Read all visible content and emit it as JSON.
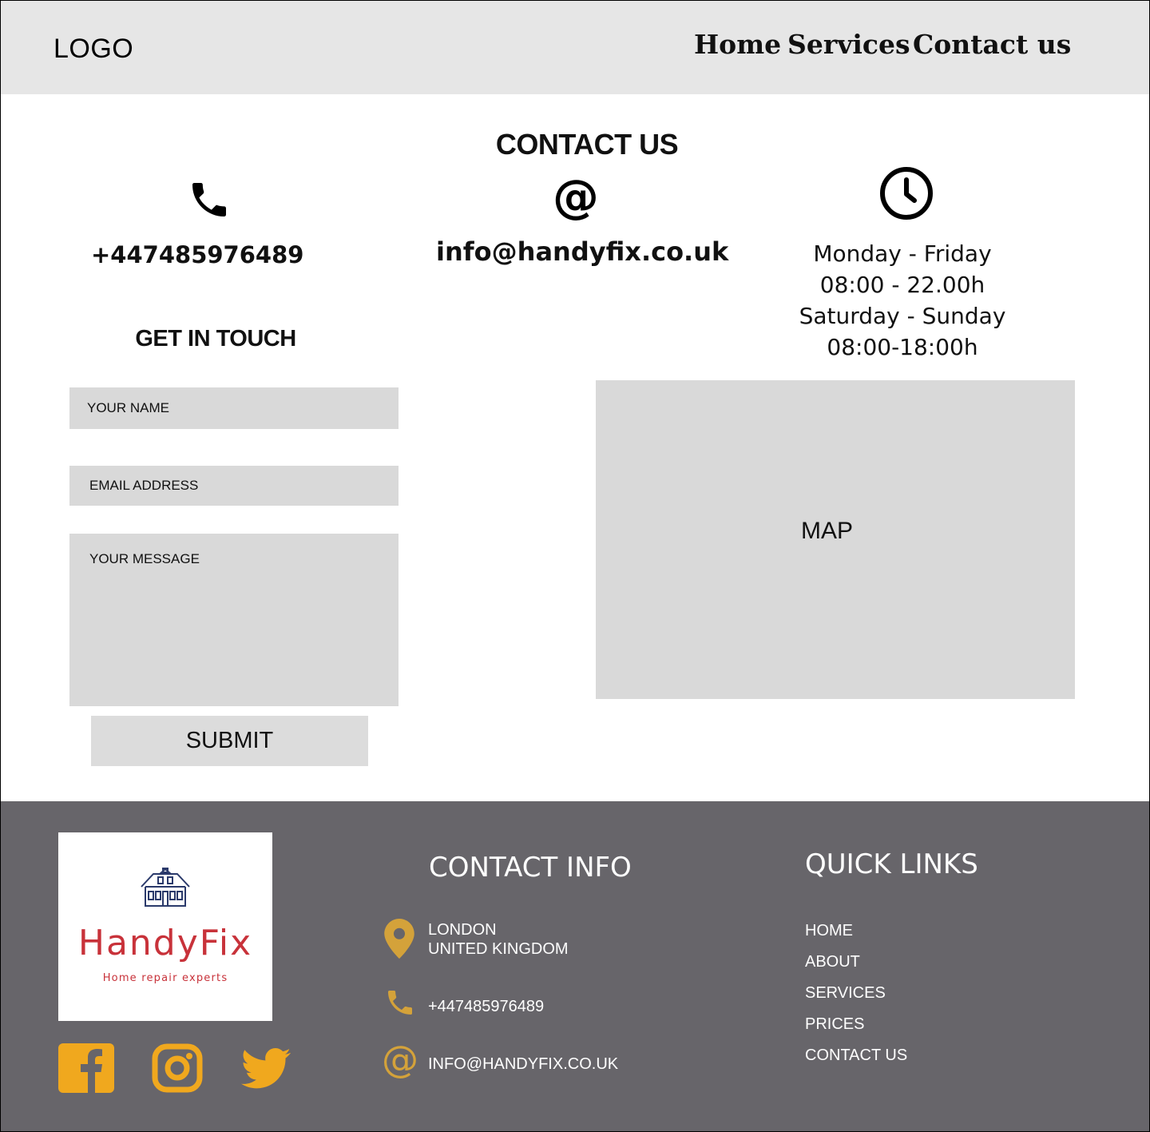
{
  "header": {
    "logo": "LOGO",
    "nav": [
      "Home",
      "Services",
      "Contact us"
    ]
  },
  "contact": {
    "title": "CONTACT US",
    "phone": "+447485976489",
    "email": "info@handyfix.co.uk",
    "hours": {
      "weekday_label": "Monday - Friday",
      "weekday_time": "08:00 - 22.00h",
      "weekend_label": "Saturday - Sunday",
      "weekend_time": "08:00-18:00h"
    }
  },
  "form": {
    "title": "GET IN TOUCH",
    "name_placeholder": "YOUR NAME",
    "email_placeholder": "EMAIL ADDRESS",
    "message_placeholder": "YOUR MESSAGE",
    "submit_label": "SUBMIT"
  },
  "map": {
    "label": "MAP"
  },
  "footer": {
    "brand": {
      "name": "HandyFix",
      "tagline": "Home repair experts"
    },
    "contact_info": {
      "heading": "CONTACT INFO",
      "location_line1": "LONDON",
      "location_line2": "UNITED KINGDOM",
      "phone": "+447485976489",
      "email": "INFO@HANDYFIX.CO.UK"
    },
    "quick_links": {
      "heading": "QUICK LINKS",
      "links": [
        "HOME",
        "ABOUT",
        "SERVICES",
        "PRICES",
        "CONTACT US"
      ]
    },
    "social_icons": [
      "facebook-icon",
      "instagram-icon",
      "twitter-icon"
    ]
  },
  "colors": {
    "header_bg": "#e6e6e6",
    "field_bg": "#d9d9d9",
    "footer_bg": "#67656a",
    "accent_gold": "#f0a81e",
    "icon_gold": "#d4a23a",
    "brand_red": "#c8323a"
  }
}
